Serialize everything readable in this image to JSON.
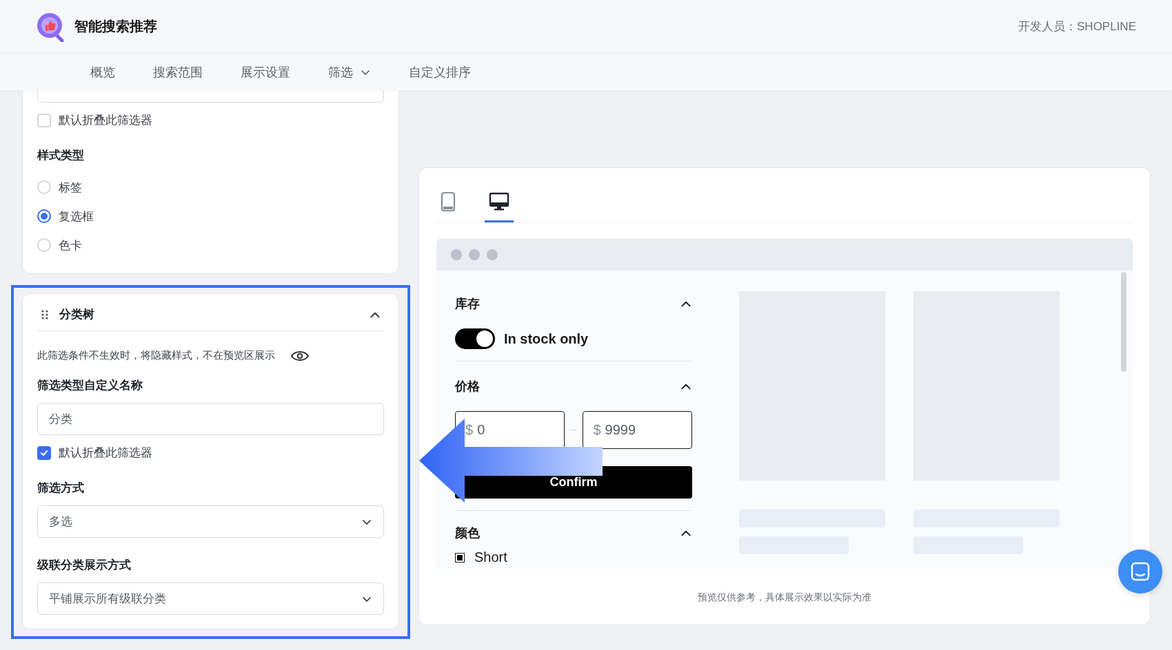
{
  "app": {
    "title": "智能搜索推荐",
    "developer": "开发人员：SHOPLINE"
  },
  "nav": [
    {
      "label": "概览",
      "selected": false,
      "has_menu": false
    },
    {
      "label": "搜索范围",
      "selected": false,
      "has_menu": false
    },
    {
      "label": "展示设置",
      "selected": false,
      "has_menu": false
    },
    {
      "label": "筛选",
      "selected": false,
      "has_menu": true
    },
    {
      "label": "自定义排序",
      "selected": false,
      "has_menu": false
    }
  ],
  "filter_card": {
    "collapse_checkbox": {
      "label": "默认折叠此筛选器",
      "checked": false
    },
    "style_type": {
      "label": "样式类型",
      "options": [
        {
          "label": "标签",
          "selected": false
        },
        {
          "label": "复选框",
          "selected": true
        },
        {
          "label": "色卡",
          "selected": false
        }
      ]
    }
  },
  "category_card": {
    "title": "分类树",
    "expanded": true,
    "highlighted": true,
    "hint": "此筛选条件不生效时，将隐藏样式，不在预览区展示",
    "name_field": {
      "label": "筛选类型自定义名称",
      "value": "分类"
    },
    "collapse_checkbox": {
      "label": "默认折叠此筛选器",
      "checked": true
    },
    "mode_select": {
      "label": "筛选方式",
      "value": "多选"
    },
    "cascade_select": {
      "label": "级联分类展示方式",
      "value": "平铺展示所有级联分类"
    }
  },
  "preview": {
    "devices": [
      {
        "kind": "mobile",
        "selected": false
      },
      {
        "kind": "desktop",
        "selected": true
      }
    ],
    "filters": [
      {
        "kind": "toggle",
        "title": "库存",
        "expanded": true,
        "label": "In stock only",
        "on": true
      },
      {
        "kind": "price",
        "title": "价格",
        "expanded": true,
        "currency": "$",
        "min": "0",
        "max": "9999",
        "button": "Confirm"
      },
      {
        "kind": "options",
        "title": "颜色",
        "expanded": true,
        "options": [
          {
            "label": "Short",
            "checked": true
          }
        ]
      }
    ],
    "note": "预览仅供参考，具体展示效果以实际为准"
  }
}
